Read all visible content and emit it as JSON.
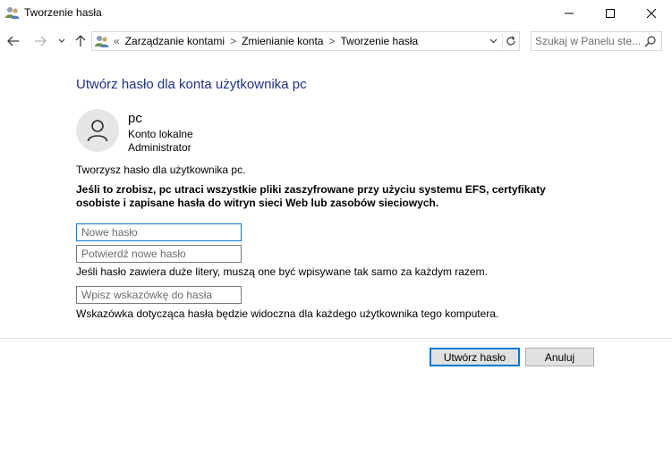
{
  "window": {
    "title": "Tworzenie hasła",
    "app_icon": "user-accounts-icon",
    "controls": [
      "minimize-icon",
      "maximize-icon",
      "close-icon"
    ]
  },
  "nav": {
    "buttons": [
      "back-arrow-icon",
      "forward-arrow-icon",
      "recent-pages-chevron-icon",
      "up-arrow-icon"
    ]
  },
  "address": {
    "lead": "«",
    "crumbs": [
      "Zarządzanie kontami",
      "Zmienianie konta",
      "Tworzenie hasła"
    ],
    "separator": ">"
  },
  "search": {
    "placeholder": "Szukaj w Panelu ste..."
  },
  "content": {
    "heading": "Utwórz hasło dla konta użytkownika pc",
    "user": {
      "name": "pc",
      "type": "Konto lokalne",
      "role": "Administrator"
    },
    "info": "Tworzysz hasło dla użytkownika pc.",
    "warning": "Jeśli to zrobisz, pc utraci wszystkie pliki zaszyfrowane przy użyciu systemu EFS, certyfikaty osobiste i zapisane hasła do witryn sieci Web lub zasobów sieciowych.",
    "fields": {
      "new_password": {
        "value": "",
        "placeholder": "Nowe hasło"
      },
      "confirm_password": {
        "value": "",
        "placeholder": "Potwierdź nowe hasło"
      },
      "hint": {
        "value": "",
        "placeholder": "Wpisz wskazówkę do hasła"
      }
    },
    "case_note": "Jeśli hasło zawiera duże litery, muszą one być wpisywane tak samo za każdym razem.",
    "hint_note": "Wskazówka dotycząca hasła będzie widoczna dla każdego użytkownika tego komputera."
  },
  "buttons": {
    "create": "Utwórz hasło",
    "cancel": "Anuluj"
  },
  "colors": {
    "heading": "#1e3287",
    "focus": "#0078d7"
  }
}
